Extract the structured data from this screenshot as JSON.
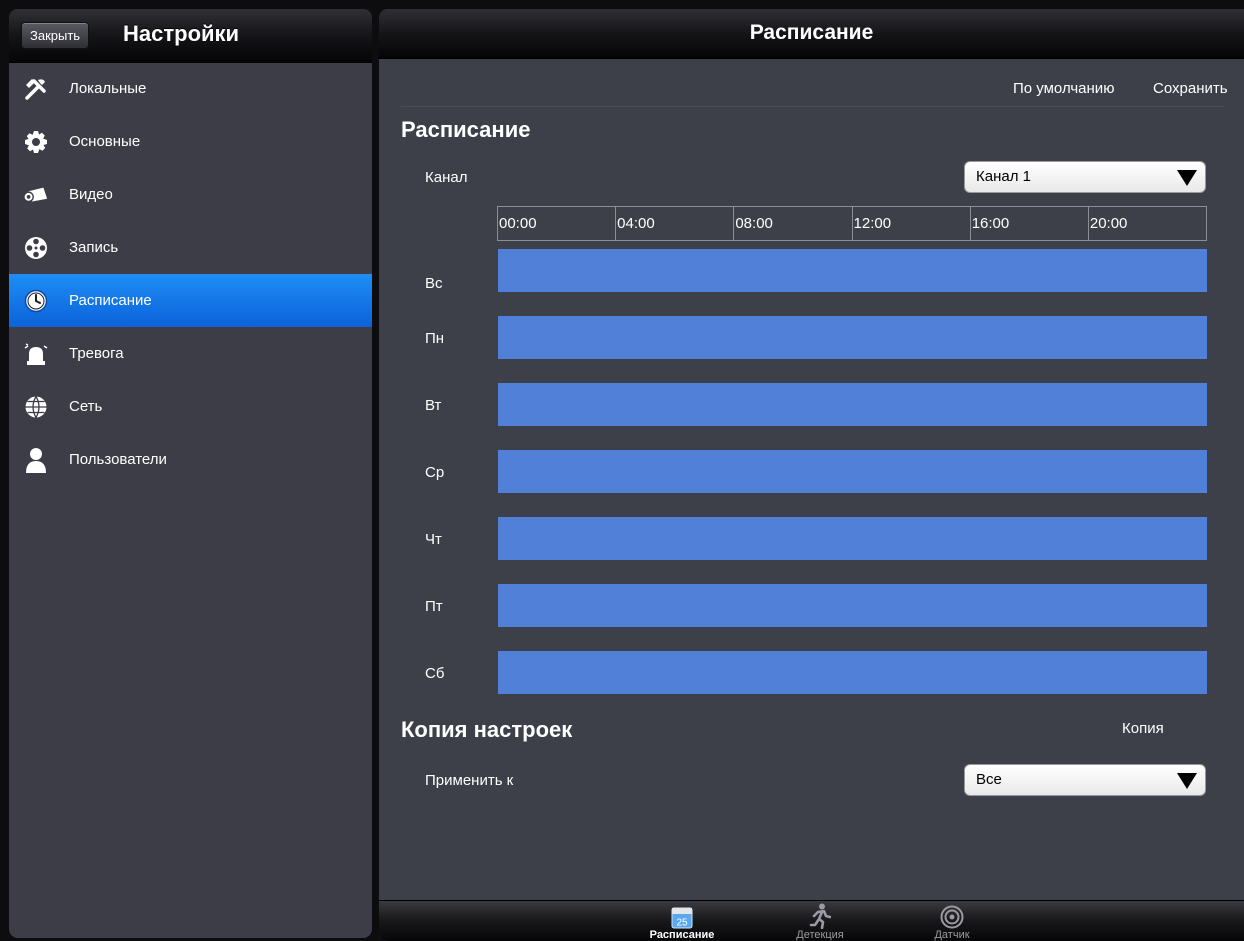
{
  "left_panel": {
    "close_label": "Закрыть",
    "title": "Настройки",
    "items": [
      {
        "label": "Локальные",
        "icon": "tools-icon"
      },
      {
        "label": "Основные",
        "icon": "gear-icon"
      },
      {
        "label": "Видео",
        "icon": "camera-icon"
      },
      {
        "label": "Запись",
        "icon": "film-reel-icon"
      },
      {
        "label": "Расписание",
        "icon": "clock-icon",
        "active": true
      },
      {
        "label": "Тревога",
        "icon": "alarm-icon"
      },
      {
        "label": "Сеть",
        "icon": "globe-icon"
      },
      {
        "label": "Пользователи",
        "icon": "user-icon"
      }
    ]
  },
  "detail": {
    "title": "Расписание",
    "default_label": "По умолчанию",
    "save_label": "Сохранить",
    "schedule_section": "Расписание",
    "channel_label": "Канал",
    "channel_value": "Канал 1",
    "time_ticks": [
      "00:00",
      "04:00",
      "08:00",
      "12:00",
      "16:00",
      "20:00"
    ],
    "days": [
      {
        "label": "Вс",
        "recording_fraction": 1.0
      },
      {
        "label": "Пн",
        "recording_fraction": 1.0
      },
      {
        "label": "Вт",
        "recording_fraction": 1.0
      },
      {
        "label": "Ср",
        "recording_fraction": 1.0
      },
      {
        "label": "Чт",
        "recording_fraction": 1.0
      },
      {
        "label": "Пт",
        "recording_fraction": 1.0
      },
      {
        "label": "Сб",
        "recording_fraction": 1.0
      }
    ],
    "copy_section": "Копия настроек",
    "copy_label": "Копия",
    "apply_label": "Применить к",
    "apply_value": "Все"
  },
  "tabs": [
    {
      "label": "Расписание",
      "icon": "calendar-icon",
      "icon_text": "25",
      "active": true
    },
    {
      "label": "Детекция",
      "icon": "running-man-icon"
    },
    {
      "label": "Датчик",
      "icon": "sensor-icon"
    }
  ],
  "colors": {
    "active_blue": "#1e8ef5",
    "schedule_bar": "#5080d8",
    "panel_bg": "#3d4049"
  }
}
